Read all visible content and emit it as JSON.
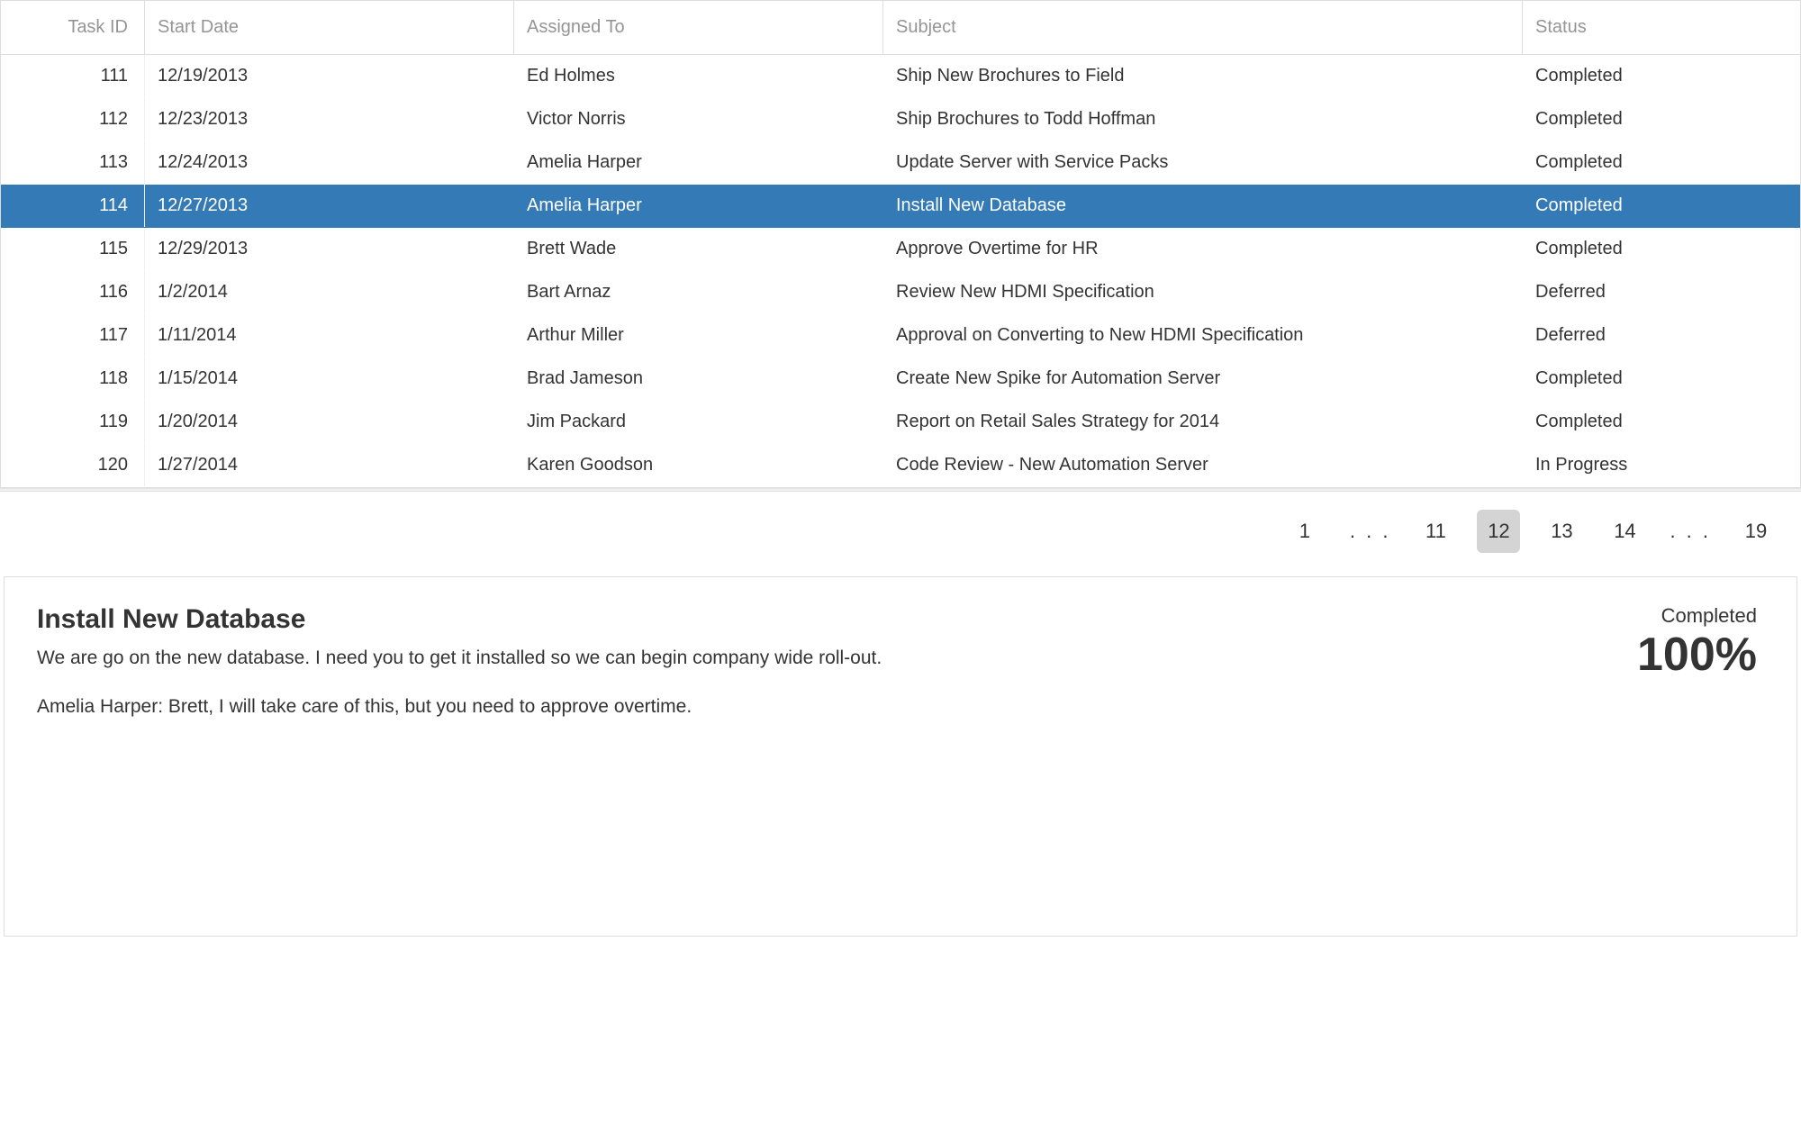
{
  "columns": {
    "task_id": "Task ID",
    "start_date": "Start Date",
    "assigned": "Assigned To",
    "subject": "Subject",
    "status": "Status"
  },
  "rows": [
    {
      "id": "111",
      "date": "12/19/2013",
      "assigned": "Ed Holmes",
      "subject": "Ship New Brochures to Field",
      "status": "Completed",
      "selected": false
    },
    {
      "id": "112",
      "date": "12/23/2013",
      "assigned": "Victor Norris",
      "subject": "Ship Brochures to Todd Hoffman",
      "status": "Completed",
      "selected": false
    },
    {
      "id": "113",
      "date": "12/24/2013",
      "assigned": "Amelia Harper",
      "subject": "Update Server with Service Packs",
      "status": "Completed",
      "selected": false
    },
    {
      "id": "114",
      "date": "12/27/2013",
      "assigned": "Amelia Harper",
      "subject": "Install New Database",
      "status": "Completed",
      "selected": true
    },
    {
      "id": "115",
      "date": "12/29/2013",
      "assigned": "Brett Wade",
      "subject": "Approve Overtime for HR",
      "status": "Completed",
      "selected": false
    },
    {
      "id": "116",
      "date": "1/2/2014",
      "assigned": "Bart Arnaz",
      "subject": "Review New HDMI Specification",
      "status": "Deferred",
      "selected": false
    },
    {
      "id": "117",
      "date": "1/11/2014",
      "assigned": "Arthur Miller",
      "subject": "Approval on Converting to New HDMI Specification",
      "status": "Deferred",
      "selected": false
    },
    {
      "id": "118",
      "date": "1/15/2014",
      "assigned": "Brad Jameson",
      "subject": "Create New Spike for Automation Server",
      "status": "Completed",
      "selected": false
    },
    {
      "id": "119",
      "date": "1/20/2014",
      "assigned": "Jim Packard",
      "subject": "Report on Retail Sales Strategy for 2014",
      "status": "Completed",
      "selected": false
    },
    {
      "id": "120",
      "date": "1/27/2014",
      "assigned": "Karen Goodson",
      "subject": "Code Review - New Automation Server",
      "status": "In Progress",
      "selected": false
    }
  ],
  "pager": {
    "items": [
      {
        "label": "1",
        "type": "page",
        "current": false
      },
      {
        "label": ". . .",
        "type": "ellipsis",
        "current": false
      },
      {
        "label": "11",
        "type": "page",
        "current": false
      },
      {
        "label": "12",
        "type": "page",
        "current": true
      },
      {
        "label": "13",
        "type": "page",
        "current": false
      },
      {
        "label": "14",
        "type": "page",
        "current": false
      },
      {
        "label": ". . .",
        "type": "ellipsis",
        "current": false
      },
      {
        "label": "19",
        "type": "page",
        "current": false
      }
    ]
  },
  "detail": {
    "title": "Install New Database",
    "body": "We are go on the new database. I need you to get it installed so we can begin company wide roll-out.",
    "comment": "Amelia Harper: Brett, I will take care of this, but you need to approve overtime.",
    "status": "Completed",
    "pct": "100%"
  }
}
